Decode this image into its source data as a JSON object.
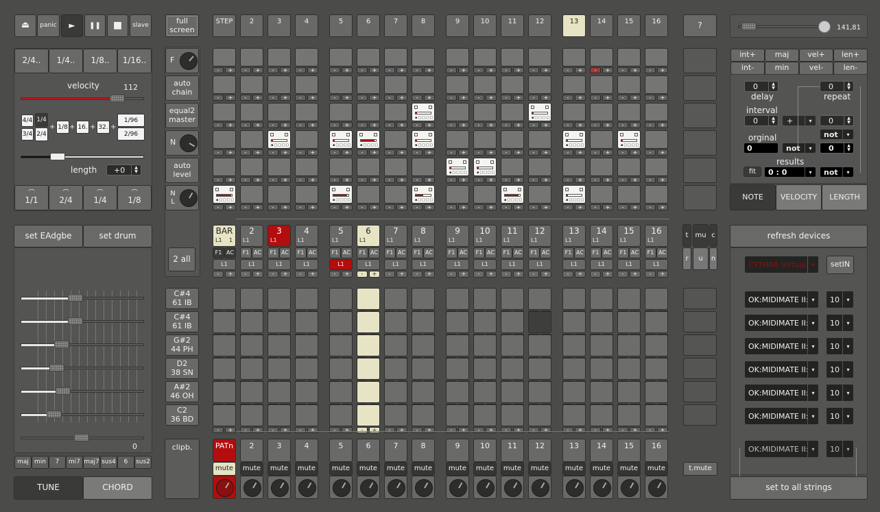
{
  "transport": {
    "eject_label": "⏏",
    "panic_label": "panic",
    "play_label": "►",
    "pause_label": "❚❚",
    "stop_label": "■",
    "slave_label": "slave",
    "fullscreen_label": "full screen",
    "help_label": "?"
  },
  "tempo": {
    "value": "141,81"
  },
  "step_header": [
    "STEP",
    "2",
    "3",
    "4",
    "5",
    "6",
    "7",
    "8",
    "9",
    "10",
    "11",
    "12",
    "13",
    "14",
    "15",
    "16"
  ],
  "active_step": 13,
  "left": {
    "meter_buttons": [
      "2/4..",
      "1/4..",
      "1/8..",
      "1/16.."
    ],
    "velocity_label": "velocity",
    "velocity_value": "112",
    "velocity_fraction": 0.82,
    "length_grid": {
      "col1": [
        "4/4",
        "3/4"
      ],
      "col2": [
        "1/4",
        "2/4"
      ],
      "singles": [
        "1/8",
        "16.",
        "32."
      ],
      "col_last": [
        "1/96",
        "2/96"
      ],
      "plus": "+"
    },
    "length_label": "length",
    "length_value": "+0",
    "length_fraction": 0.28,
    "tie_buttons": [
      "1/1",
      "2/4",
      "1/4",
      "1/8"
    ],
    "tie_mark": "⌒",
    "set_tuning_label": "set EAdgbe",
    "set_drum_label": "set drum",
    "string_sliders": [
      0.4,
      0.4,
      0.29,
      0.25,
      0.3,
      0.23
    ],
    "master_slider": 0.5,
    "master_value": "0",
    "chord_buttons": [
      "maj",
      "min",
      "7",
      "mi7",
      "maj7",
      "sus4",
      "6",
      "sus2"
    ],
    "tune_tab": "TUNE",
    "chord_tab": "CHORD"
  },
  "side_column": {
    "f_label": "F",
    "auto_chain": "auto chain",
    "equal2master": "equal2 master",
    "n_label": "N",
    "auto_level": "auto level",
    "nl_label": "N L",
    "two_all": "2 all",
    "drum_notes": [
      {
        "note": "C#4",
        "name": "61 IB"
      },
      {
        "note": "C#4",
        "name": "61 IB"
      },
      {
        "note": "G#2",
        "name": "44 PH"
      },
      {
        "note": "D2",
        "name": "38 SN"
      },
      {
        "note": "A#2",
        "name": "46 OH"
      },
      {
        "note": "C2",
        "name": "36 BD"
      }
    ],
    "clipboard": "clipb."
  },
  "grid": {
    "minus": "-",
    "plus": "+",
    "active_cells": [
      {
        "row": 2,
        "col": 7,
        "fill": 0.1
      },
      {
        "row": 2,
        "col": 11,
        "fill": 0.1
      },
      {
        "row": 3,
        "col": 2,
        "fill": 0.1
      },
      {
        "row": 3,
        "col": 4,
        "fill": 0.1
      },
      {
        "row": 3,
        "col": 5,
        "fill": 0.9
      },
      {
        "row": 3,
        "col": 7,
        "fill": 0.1
      },
      {
        "row": 3,
        "col": 12,
        "fill": 0.1
      },
      {
        "row": 3,
        "col": 14,
        "fill": 0.1
      },
      {
        "row": 4,
        "col": 8,
        "fill": 0.1
      },
      {
        "row": 4,
        "col": 9,
        "fill": 0.1
      },
      {
        "row": 5,
        "col": 0,
        "fill": 0.95
      },
      {
        "row": 5,
        "col": 4,
        "fill": 0.9
      },
      {
        "row": 5,
        "col": 7,
        "fill": 0.5
      },
      {
        "row": 5,
        "col": 10,
        "fill": 0.9
      },
      {
        "row": 5,
        "col": 12,
        "fill": 0.1
      }
    ]
  },
  "bars": {
    "labels": [
      "BAR",
      "2",
      "3",
      "4",
      "5",
      "6",
      "7",
      "8",
      "9",
      "10",
      "11",
      "12",
      "13",
      "14",
      "15",
      "16"
    ],
    "sub_label": "L1",
    "bar_extra": "1",
    "f1": "F1",
    "ac": "AC",
    "loop": "L1",
    "red_index": 2,
    "cream_indices": [
      0,
      5
    ],
    "red_loop_index": 4
  },
  "string_toggles": {
    "t": "t",
    "mu": "mu",
    "c": "c",
    "r": "r",
    "u": "u",
    "n": "n"
  },
  "patterns": {
    "labels": [
      "PATn",
      "2",
      "3",
      "4",
      "5",
      "6",
      "7",
      "8",
      "9",
      "10",
      "11",
      "12",
      "13",
      "14",
      "15",
      "16"
    ],
    "mute": "mute",
    "t_mute": "t.mute"
  },
  "right": {
    "mod_buttons": [
      [
        "int+",
        "maj",
        "vel+",
        "len+"
      ],
      [
        "int-",
        "min",
        "vel-",
        "len-"
      ]
    ],
    "delay_value": "0",
    "delay_label": "delay",
    "repeat_value": "0",
    "repeat_label": "repeat",
    "interval_label": "interval",
    "interval_value": "0",
    "op_value": "+",
    "op_operand": "0",
    "not1": "not",
    "original_label": "orginal",
    "original_value": "0",
    "not2": "not",
    "orig_operand": "0",
    "results_label": "results",
    "fit_label": "fit",
    "results_value": "0 : 0",
    "not3": "not",
    "tabs": [
      "NOTE",
      "VELOCITY",
      "LENGTH"
    ],
    "refresh_devices": "refresh devices",
    "input_device": "CYTHAR Virtual",
    "set_in": "setIN",
    "outputs": [
      {
        "device": "OK:MIDIMATE II:",
        "channel": "10"
      },
      {
        "device": "OK:MIDIMATE II:",
        "channel": "10"
      },
      {
        "device": "OK:MIDIMATE II:",
        "channel": "10"
      },
      {
        "device": "OK:MIDIMATE II:",
        "channel": "10"
      },
      {
        "device": "OK:MIDIMATE II:",
        "channel": "10"
      },
      {
        "device": "OK:MIDIMATE II:",
        "channel": "10"
      }
    ],
    "all_device": "OK:MIDIMATE II:",
    "all_channel": "10",
    "set_all": "set to all strings",
    "arrow": "▾"
  }
}
